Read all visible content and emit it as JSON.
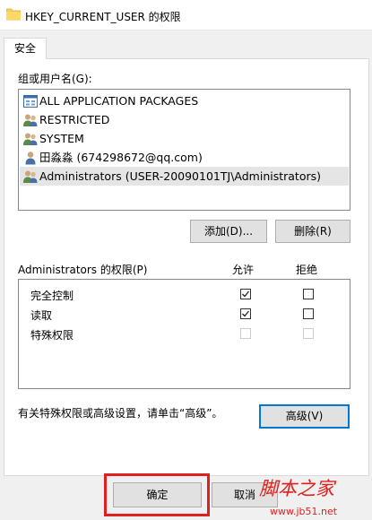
{
  "window": {
    "title": "HKEY_CURRENT_USER 的权限",
    "icon": "folder-icon"
  },
  "tabs": [
    {
      "label": "安全",
      "active": true
    }
  ],
  "groups": {
    "label": "组或用户名(G):",
    "items": [
      {
        "name": "ALL APPLICATION PACKAGES",
        "icon": "app-packages-icon",
        "selected": false
      },
      {
        "name": "RESTRICTED",
        "icon": "users-group-icon",
        "selected": false
      },
      {
        "name": "SYSTEM",
        "icon": "users-group-icon",
        "selected": false
      },
      {
        "name": "田淼淼 (674298672@qq.com)",
        "icon": "user-icon",
        "selected": false
      },
      {
        "name": "Administrators (USER-20090101TJ\\Administrators)",
        "icon": "users-group-icon",
        "selected": true
      }
    ]
  },
  "buttons": {
    "add": "添加(D)...",
    "remove": "删除(R)",
    "advanced": "高级(V)",
    "ok": "确定",
    "cancel": "取消"
  },
  "permissions": {
    "label": "Administrators 的权限(P)",
    "allow_header": "允许",
    "deny_header": "拒绝",
    "rows": [
      {
        "name": "完全控制",
        "allow": true,
        "deny": false,
        "enabled": true
      },
      {
        "name": "读取",
        "allow": true,
        "deny": false,
        "enabled": true
      },
      {
        "name": "特殊权限",
        "allow": false,
        "deny": false,
        "enabled": false
      }
    ]
  },
  "advanced_note": "有关特殊权限或高级设置，请单击“高级”。",
  "watermark": {
    "brand": "脚本之家",
    "url": "www.jb51.net"
  },
  "colors": {
    "accent": "#0078d7",
    "highlight": "#e0201e",
    "watermark": "#e0201e"
  }
}
